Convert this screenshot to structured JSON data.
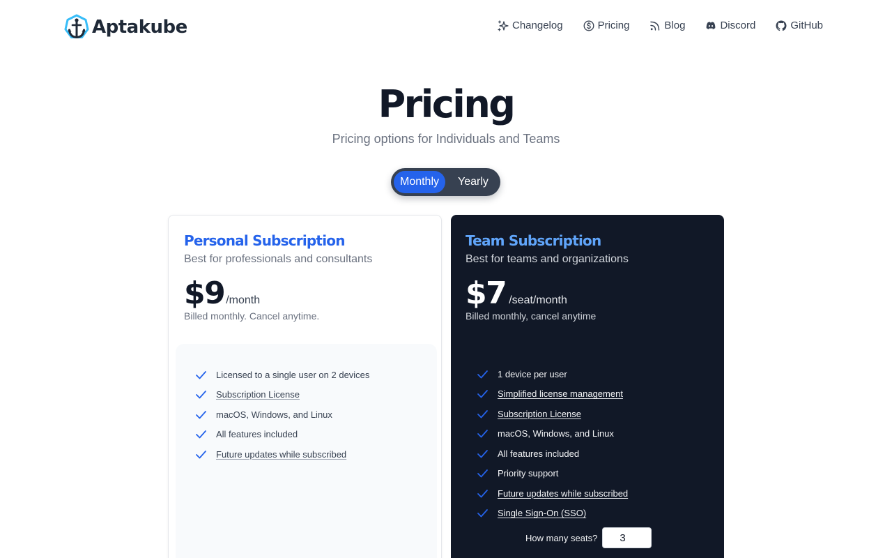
{
  "brand": {
    "name": "Aptakube"
  },
  "nav": {
    "items": [
      {
        "label": "Changelog",
        "icon": "sparkles-icon"
      },
      {
        "label": "Pricing",
        "icon": "dollar-circle-icon"
      },
      {
        "label": "Blog",
        "icon": "rss-icon"
      },
      {
        "label": "Discord",
        "icon": "discord-icon"
      },
      {
        "label": "GitHub",
        "icon": "github-icon"
      }
    ]
  },
  "hero": {
    "title": "Pricing",
    "subtitle": "Pricing options for Individuals and Teams"
  },
  "billing_toggle": {
    "options": [
      "Monthly",
      "Yearly"
    ],
    "selected": "Monthly"
  },
  "plans": [
    {
      "title": "Personal Subscription",
      "description": "Best for professionals and consultants",
      "price": "$9",
      "period": "/month",
      "billing_note": "Billed monthly. Cancel anytime.",
      "features": [
        {
          "text": "Licensed to a single user on 2 devices",
          "link": false
        },
        {
          "text": "Subscription License",
          "link": true
        },
        {
          "text": "macOS, Windows, and Linux",
          "link": false
        },
        {
          "text": "All features included",
          "link": false
        },
        {
          "text": "Future updates while subscribed",
          "link": true
        }
      ]
    },
    {
      "title": "Team Subscription",
      "description": "Best for teams and organizations",
      "price": "$7",
      "period": "/seat/month",
      "billing_note": "Billed monthly, cancel anytime",
      "features": [
        {
          "text": "1 device per user",
          "link": false
        },
        {
          "text": "Simplified license management",
          "link": true
        },
        {
          "text": "Subscription License",
          "link": true
        },
        {
          "text": "macOS, Windows, and Linux",
          "link": false
        },
        {
          "text": "All features included",
          "link": false
        },
        {
          "text": "Priority support",
          "link": false
        },
        {
          "text": "Future updates while subscribed",
          "link": true
        },
        {
          "text": "Single Sign-On (SSO)",
          "link": true
        }
      ],
      "seats": {
        "label": "How many seats?",
        "value": "3"
      }
    }
  ],
  "colors": {
    "accent": "#2563eb",
    "team_title": "#60a5fa",
    "dark_card": "#111827",
    "toggle_bg": "#374151"
  }
}
